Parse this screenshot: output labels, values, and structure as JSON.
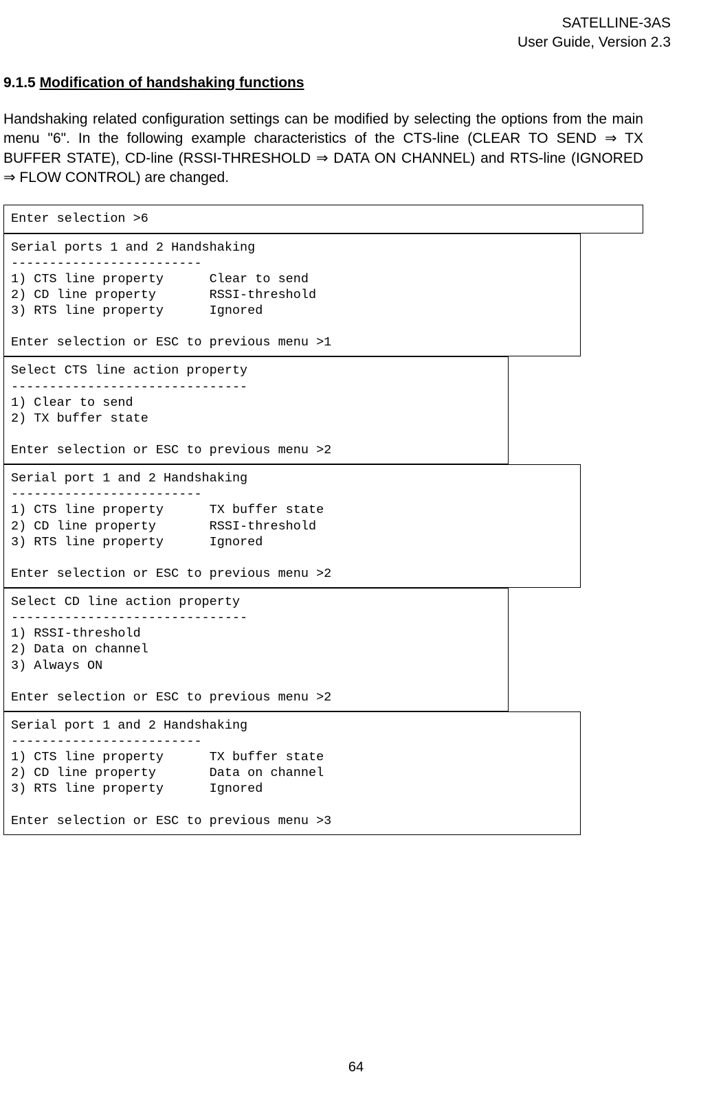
{
  "header": {
    "line1": "SATELLINE-3AS",
    "line2": "User Guide, Version 2.3"
  },
  "section": {
    "number": "9.1.5",
    "title": "Modification of handshaking functions"
  },
  "paragraph": "Handshaking related configuration settings can be modified by selecting the options from the main menu \"6\". In the following example characteristics of the CTS-line (CLEAR TO SEND ⇒ TX BUFFER STATE), CD-line (RSSI-THRESHOLD ⇒ DATA ON CHANNEL) and RTS-line (IGNORED ⇒ FLOW CONTROL) are changed.",
  "boxes": {
    "b1": "Enter selection >6",
    "b2": "Serial ports 1 and 2 Handshaking\n-------------------------\n1) CTS line property      Clear to send\n2) CD line property       RSSI-threshold\n3) RTS line property      Ignored\n\nEnter selection or ESC to previous menu >1",
    "b3": "Select CTS line action property\n-------------------------------\n1) Clear to send\n2) TX buffer state\n\nEnter selection or ESC to previous menu >2",
    "b4": "Serial port 1 and 2 Handshaking\n-------------------------\n1) CTS line property      TX buffer state\n2) CD line property       RSSI-threshold\n3) RTS line property      Ignored\n\nEnter selection or ESC to previous menu >2",
    "b5": "Select CD line action property\n-------------------------------\n1) RSSI-threshold\n2) Data on channel\n3) Always ON\n\nEnter selection or ESC to previous menu >2",
    "b6": "Serial port 1 and 2 Handshaking\n-------------------------\n1) CTS line property      TX buffer state\n2) CD line property       Data on channel\n3) RTS line property      Ignored\n\nEnter selection or ESC to previous menu >3"
  },
  "page_number": "64"
}
